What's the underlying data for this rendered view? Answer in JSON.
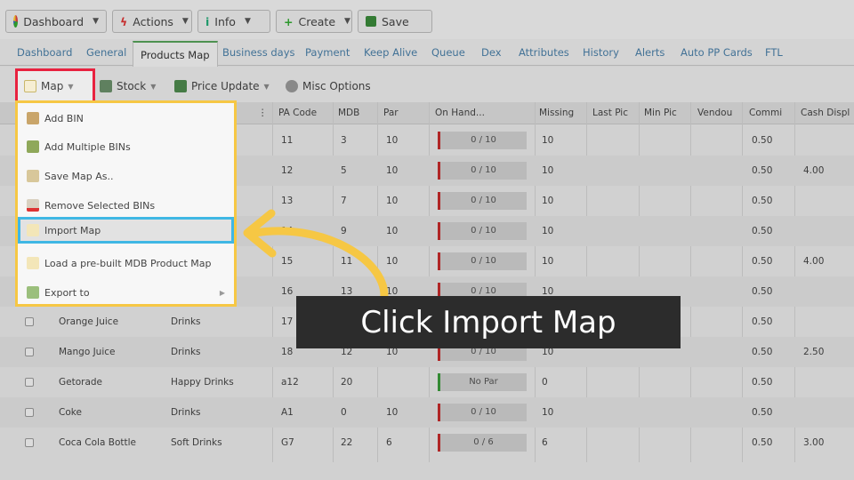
{
  "toolbar": {
    "dashboard_label": "Dashboard",
    "actions_label": "Actions",
    "info_label": "Info",
    "create_label": "Create",
    "save_label": "Save"
  },
  "tabs": [
    "Dashboard",
    "General",
    "Products Map",
    "Business days",
    "Payment",
    "Keep Alive",
    "Queue",
    "Dex",
    "Attributes",
    "History",
    "Alerts",
    "Auto PP Cards",
    "FTL"
  ],
  "subtoolbar": {
    "map_label": "Map",
    "stock_label": "Stock",
    "price_update_label": "Price Update",
    "misc_label": "Misc Options"
  },
  "columns": [
    "PA Code",
    "MDB",
    "Par",
    "On Hand...",
    "Missing",
    "Last Pic",
    "Min Pic",
    "Vendou",
    "Commi",
    "Cash Displ"
  ],
  "rows": [
    {
      "name": "",
      "category": "",
      "pa": "11",
      "mdb": "3",
      "par": "10",
      "onhand": "0 / 10",
      "missing": "10",
      "comm": "0.50",
      "cash": ""
    },
    {
      "name": "",
      "category": "",
      "pa": "12",
      "mdb": "5",
      "par": "10",
      "onhand": "0 / 10",
      "missing": "10",
      "comm": "0.50",
      "cash": "4.00"
    },
    {
      "name": "",
      "category": "",
      "pa": "13",
      "mdb": "7",
      "par": "10",
      "onhand": "0 / 10",
      "missing": "10",
      "comm": "0.50",
      "cash": ""
    },
    {
      "name": "",
      "category": "",
      "pa": "14",
      "mdb": "9",
      "par": "10",
      "onhand": "0 / 10",
      "missing": "10",
      "comm": "0.50",
      "cash": ""
    },
    {
      "name": "",
      "category": "",
      "pa": "15",
      "mdb": "11",
      "par": "10",
      "onhand": "0 / 10",
      "missing": "10",
      "comm": "0.50",
      "cash": "4.00"
    },
    {
      "name": "",
      "category": "",
      "pa": "16",
      "mdb": "13",
      "par": "10",
      "onhand": "0 / 10",
      "missing": "10",
      "comm": "0.50",
      "cash": ""
    },
    {
      "name": "Orange Juice",
      "category": "Drinks",
      "pa": "17",
      "mdb": "",
      "par": "",
      "onhand": "",
      "missing": "",
      "comm": "0.50",
      "cash": ""
    },
    {
      "name": "Mango Juice",
      "category": "Drinks",
      "pa": "18",
      "mdb": "12",
      "par": "10",
      "onhand": "0 / 10",
      "missing": "10",
      "comm": "0.50",
      "cash": "2.50"
    },
    {
      "name": "Getorade",
      "category": "Happy Drinks",
      "pa": "a12",
      "mdb": "20",
      "par": "",
      "onhand": "No Par",
      "missing": "0",
      "comm": "0.50",
      "cash": ""
    },
    {
      "name": "Coke",
      "category": "Drinks",
      "pa": "A1",
      "mdb": "0",
      "par": "10",
      "onhand": "0 / 10",
      "missing": "10",
      "comm": "0.50",
      "cash": ""
    },
    {
      "name": "Coca Cola Bottle",
      "category": "Soft Drinks",
      "pa": "G7",
      "mdb": "22",
      "par": "6",
      "onhand": "0 / 6",
      "missing": "6",
      "comm": "0.50",
      "cash": "3.00"
    }
  ],
  "map_menu": {
    "items": [
      "Add BIN",
      "Add Multiple BINs",
      "Save Map As..",
      "Remove Selected BINs",
      "Import Map",
      "Load a pre-built MDB Product Map",
      "Export to"
    ]
  },
  "callout": {
    "text": "Click Import Map"
  },
  "colors": {
    "highlight_red": "#e8223f",
    "highlight_yellow": "#f6c744",
    "highlight_blue": "#3fb7e4",
    "onhand_red": "#c42b2b",
    "onhand_green": "#3a9a3a"
  }
}
